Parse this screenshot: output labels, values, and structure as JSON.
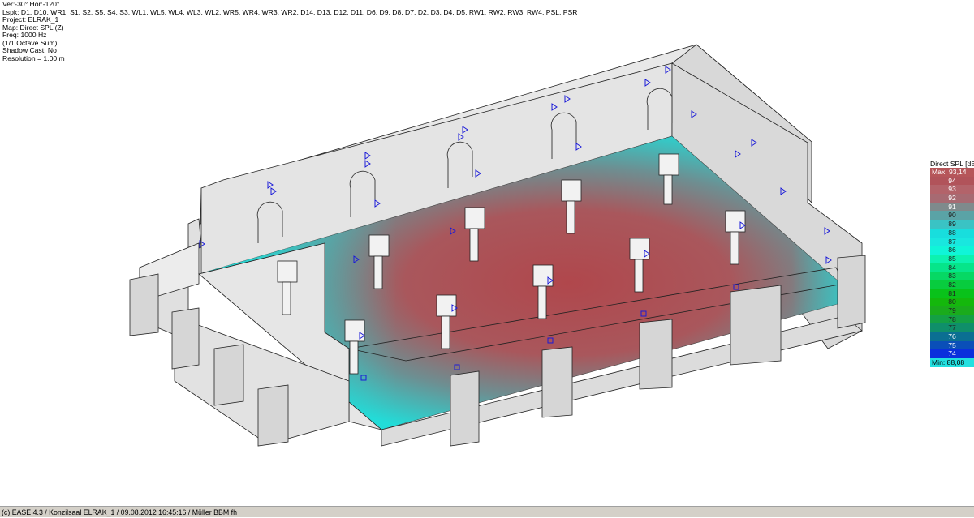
{
  "info": {
    "view": "Ver:-30°  Hor:-120°",
    "lspk": "Lspk: D1, D10, WR1, S1, S2, S5, S4, S3, WL1, WL5, WL4, WL3, WL2, WR5, WR4, WR3, WR2, D14, D13, D12, D11, D6, D9, D8, D7, D2, D3, D4, D5, RW1, RW2, RW3, RW4, PSL, PSR",
    "project": "Project: ELRAK_1",
    "map": "Map: Direct SPL (Z)",
    "freq": "Freq: 1000 Hz",
    "band": "(1/1 Octave Sum)",
    "shadow": "Shadow Cast: No",
    "resolution": "Resolution =   1.00 m"
  },
  "legend": {
    "title": "Direct SPL [dB]",
    "max_label": "Max:  93,14",
    "min_label": "Min:  88,08",
    "steps": [
      {
        "label": "94",
        "color": "#b1535a"
      },
      {
        "label": "93",
        "color": "#b3636a"
      },
      {
        "label": "92",
        "color": "#a76a72"
      },
      {
        "label": "91",
        "color": "#7f8a8c"
      },
      {
        "label": "90",
        "color": "#5aa3a6"
      },
      {
        "label": "89",
        "color": "#3ac3c4"
      },
      {
        "label": "88",
        "color": "#18dedd"
      },
      {
        "label": "87",
        "color": "#19e7df"
      },
      {
        "label": "86",
        "color": "#10f5d8"
      },
      {
        "label": "85",
        "color": "#0cf2b0"
      },
      {
        "label": "84",
        "color": "#06e58a"
      },
      {
        "label": "83",
        "color": "#06d864"
      },
      {
        "label": "82",
        "color": "#08cc3e"
      },
      {
        "label": "81",
        "color": "#09c21a"
      },
      {
        "label": "80",
        "color": "#14b80c"
      },
      {
        "label": "79",
        "color": "#1aab1c"
      },
      {
        "label": "78",
        "color": "#14a044"
      },
      {
        "label": "77",
        "color": "#0f8f6a"
      },
      {
        "label": "76",
        "color": "#0b6f92"
      },
      {
        "label": "75",
        "color": "#0a4fb8"
      },
      {
        "label": "74",
        "color": "#0a2fdc"
      }
    ]
  },
  "status": "(c) EASE 4.3  / Konzilsaal ELRAK_1 / 09.08.2012 16:45:16 / Müller BBM fh",
  "colors": {
    "hot": "#b45055",
    "cool": "#22d6d2",
    "wall": "#e6e6e6",
    "speaker": "#1a1ad8"
  }
}
